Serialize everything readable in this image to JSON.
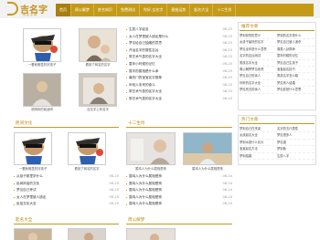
{
  "logo": {
    "title": "吉名字",
    "subtitle": "吉名字网"
  },
  "nav": [
    "首页",
    "周公解梦",
    "姓名知识",
    "免费测试",
    "你好,吉名字",
    "星座运势",
    "起名大全",
    "十二生肖"
  ],
  "main_list": [
    [
      "生辰八字起名",
      "06-25"
    ],
    [
      "女人在梦里被人掳走是什么",
      "06-25"
    ],
    [
      "梦见给自己抽烟的意思",
      "06-25"
    ],
    [
      "开运名字的属性吉凶",
      "06-25"
    ],
    [
      "带艺术气息的名字大全",
      "06-25"
    ],
    [
      "童年小时候的记忆",
      "06-25"
    ],
    [
      "属羊的属相是什么命",
      "06-25"
    ],
    [
      "最热门的宝宝名字推荐",
      "06-25"
    ],
    [
      "年轻人未来的奋斗",
      "06-25"
    ],
    [
      "带艺术气息的名字大全",
      "06-25"
    ],
    [
      "带艺术气息的名字大全",
      "06-25"
    ]
  ],
  "top_captions": [
    "一看就明显的好孩子",
    "看到了网名的名字",
    "说明你的前途呀",
    "吉名字上有名字"
  ],
  "side1": {
    "title": "推荐文章",
    "items": [
      [
        "梦到领导的意义",
        "梦到的名字是什么"
      ],
      [
        "女孩子最好的名字",
        "梦见自己被人追杀"
      ],
      [
        "梦见坐车是什么意思",
        "周易八卦算命"
      ],
      [
        "名字的吉凶测试",
        "童年时候的记忆"
      ],
      [
        "男孩名字大全",
        "梦见自己生孩子"
      ],
      [
        "周公解梦梦见老虎",
        "宝宝起名技巧"
      ],
      [
        "梦见自己的亲人",
        "男孩名字怎么取"
      ],
      [
        "好听的名字大全",
        "梦见别人结婚"
      ],
      [
        "梦见死去的亲人",
        "梦见蛇是什么意思"
      ]
    ]
  },
  "side2": {
    "title": "热门文章",
    "items": [
      [
        "梦到自己在洗澡",
        "名字的五行属性"
      ],
      [
        "女孩起名大全",
        "梦见很多人"
      ],
      [
        "梦到水是什么兆头",
        "梦见猫"
      ],
      [
        "宝宝起名方法",
        "梦到鱼"
      ],
      [
        "梦到结婚",
        "生辰八字"
      ]
    ]
  },
  "sec1": {
    "title": "民间文化",
    "captions": [
      "一看就明显的好孩子",
      "看到了网名的名字"
    ],
    "items": [
      [
        "从孩子那里学什么",
        "06-25"
      ],
      [
        "民间风俗的文化",
        "06-25"
      ],
      [
        "梦见自己考试",
        "06-25"
      ],
      [
        "女人在梦里被人掳走",
        "06-25"
      ],
      [
        "民俗文化大全",
        "06-25"
      ]
    ]
  },
  "sec2": {
    "title": "十二生肖",
    "captions": [
      "属鸡人为什么属相是狗",
      "属鸡人为什么属相是狗"
    ],
    "items": [
      [
        "属鸡人为什么属相是狗",
        "06-24"
      ],
      [
        "属鸡人为什么属相是狗",
        "06-24"
      ],
      [
        "属鸡人为什么属相是狗",
        "06-24"
      ],
      [
        "属鸡人为什么属相是狗",
        "06-24"
      ],
      [
        "属鸡人为什么属相是狗",
        "06-24"
      ]
    ]
  },
  "sec3": {
    "title": "起名大全"
  },
  "sec4": {
    "title": "周公解梦"
  }
}
